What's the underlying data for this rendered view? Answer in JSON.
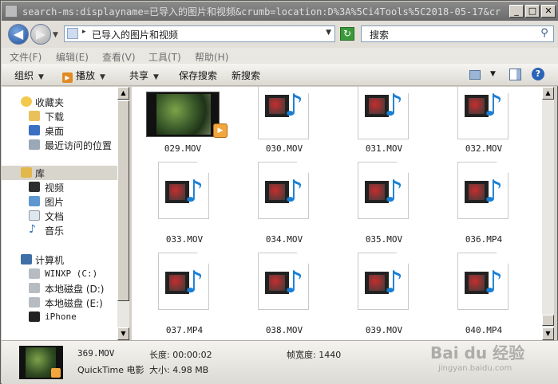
{
  "window": {
    "title": "search-ms:displayname=已导入的图片和视频&crumb=location:D%3A%5Ci4Tools%5C2018-05-17&cr...",
    "buttons": {
      "minimize": "_",
      "maximize": "□",
      "close": "✕"
    }
  },
  "nav": {
    "back_icon": "arrow-left-icon",
    "forward_icon": "arrow-right-icon"
  },
  "address": {
    "path": "已导入的图片和视频",
    "breadcrumb_arrow": "▸"
  },
  "search": {
    "placeholder": "搜索"
  },
  "menubar": {
    "items": [
      {
        "label": "文件(F)"
      },
      {
        "label": "编辑(E)"
      },
      {
        "label": "查看(V)"
      },
      {
        "label": "工具(T)"
      },
      {
        "label": "帮助(H)"
      }
    ]
  },
  "toolbar": {
    "organize": "组织",
    "play": "播放",
    "share": "共享",
    "save_search": "保存搜索",
    "new_search": "新搜索"
  },
  "sidebar": {
    "favorites": {
      "label": "收藏夹",
      "items": [
        {
          "label": "下载",
          "icon": "download-folder-icon"
        },
        {
          "label": "桌面",
          "icon": "desktop-icon"
        },
        {
          "label": "最近访问的位置",
          "icon": "recent-places-icon"
        }
      ]
    },
    "libraries": {
      "label": "库",
      "items": [
        {
          "label": "视频",
          "icon": "video-library-icon"
        },
        {
          "label": "图片",
          "icon": "picture-library-icon"
        },
        {
          "label": "文档",
          "icon": "document-library-icon"
        },
        {
          "label": "音乐",
          "icon": "music-library-icon"
        }
      ]
    },
    "computer": {
      "label": "计算机",
      "items": [
        {
          "label": "WINXP (C:)",
          "icon": "drive-c-icon"
        },
        {
          "label": "本地磁盘 (D:)",
          "icon": "drive-d-icon"
        },
        {
          "label": "本地磁盘 (E:)",
          "icon": "drive-e-icon"
        },
        {
          "label": "iPhone",
          "icon": "iphone-icon"
        }
      ]
    }
  },
  "files": [
    {
      "name": "029.MOV",
      "type": "video-thumbnail"
    },
    {
      "name": "030.MOV",
      "type": "media-file"
    },
    {
      "name": "031.MOV",
      "type": "media-file"
    },
    {
      "name": "032.MOV",
      "type": "media-file"
    },
    {
      "name": "033.MOV",
      "type": "media-file"
    },
    {
      "name": "034.MOV",
      "type": "media-file"
    },
    {
      "name": "035.MOV",
      "type": "media-file"
    },
    {
      "name": "036.MP4",
      "type": "media-file"
    },
    {
      "name": "037.MP4",
      "type": "media-file"
    },
    {
      "name": "038.MOV",
      "type": "media-file"
    },
    {
      "name": "039.MOV",
      "type": "media-file"
    },
    {
      "name": "040.MP4",
      "type": "media-file"
    }
  ],
  "details": {
    "filename": "369.MOV",
    "filetype": "QuickTime 电影",
    "length_label": "长度: 00:00:02",
    "size_label": "大小: 4.98 MB",
    "framewidth_label": "帧宽度: 1440"
  },
  "watermark": {
    "brand": "Bai du 经验",
    "url": "jingyan.baidu.com"
  }
}
